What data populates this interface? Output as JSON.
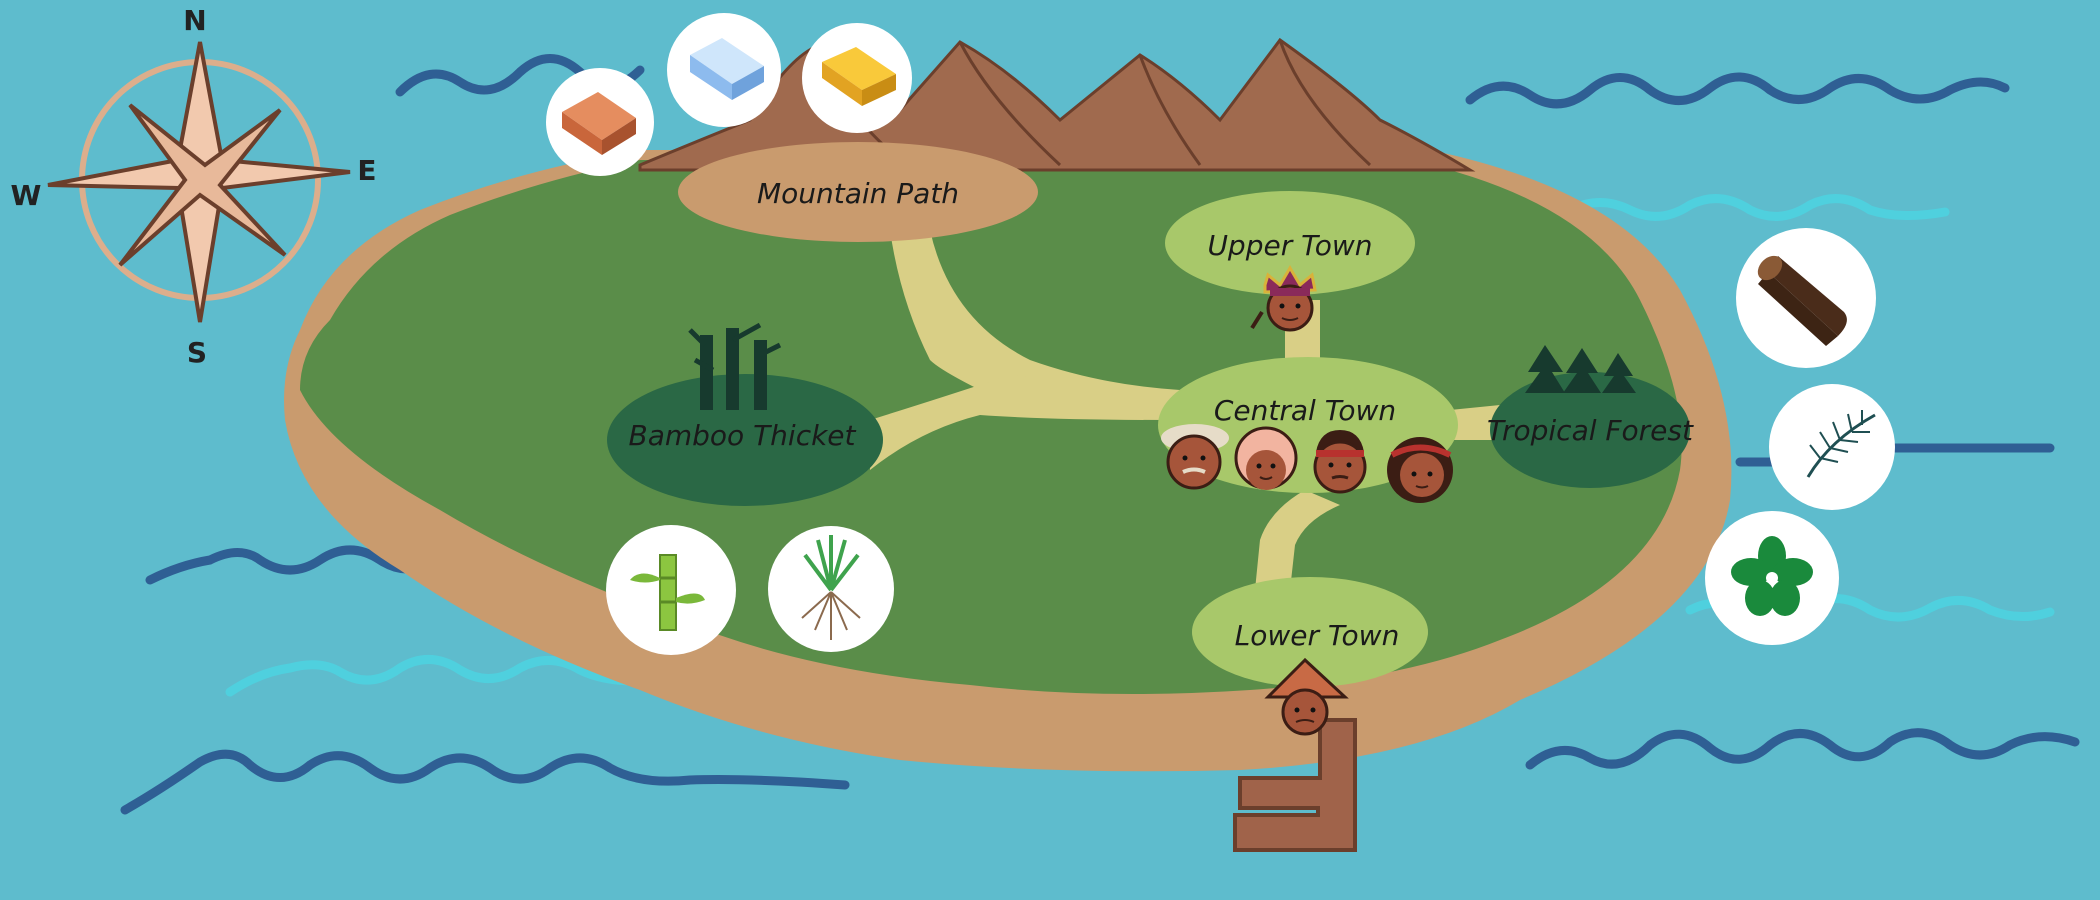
{
  "colors": {
    "ocean": "#5ebccd",
    "wave_dark": "#2f5f94",
    "wave_light": "#4fd0de",
    "sand": "#c99b6e",
    "grass": "#5a8d49",
    "clearing": "#a8c86a",
    "path": "#d9cf86",
    "forest_dark": "#2a6845",
    "mountain": "#a06a4e"
  },
  "compass": {
    "north": "N",
    "south": "S",
    "east": "E",
    "west": "W"
  },
  "locations": {
    "mountain_path": "Mountain Path",
    "upper_town": "Upper Town",
    "central_town": "Central Town",
    "bamboo_thicket": "Bamboo Thicket",
    "tropical_forest": "Tropical Forest",
    "lower_town": "Lower Town"
  },
  "resources": {
    "mountain_path": [
      "copper-ingot-icon",
      "silver-ingot-icon",
      "gold-ingot-icon"
    ],
    "bamboo_thicket": [
      "bamboo-icon",
      "grass-roots-icon"
    ],
    "tropical_forest": [
      "wood-log-icon",
      "palm-leaf-icon",
      "green-flower-icon"
    ]
  },
  "characters": {
    "upper_town": [
      "chief-with-headdress-avatar"
    ],
    "central_town": [
      "elder-man-avatar",
      "elder-woman-avatar",
      "warrior-with-headband-avatar",
      "girl-with-red-headband-avatar"
    ],
    "lower_town": [
      "man-with-conical-hat-avatar"
    ]
  }
}
